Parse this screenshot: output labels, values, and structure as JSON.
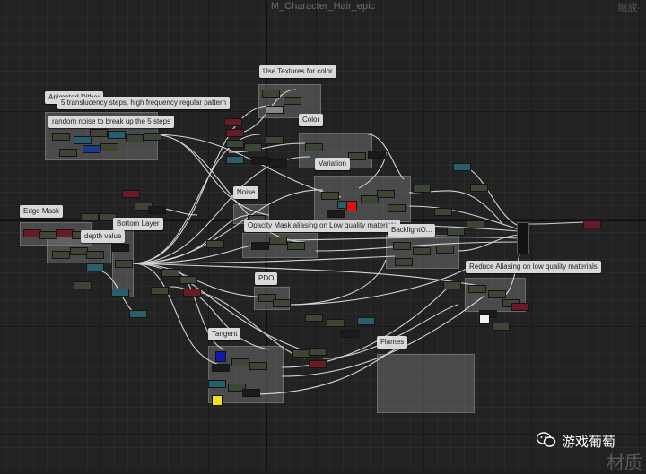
{
  "editor": {
    "title": "M_Character_Hair_epic",
    "zoom_label": "缩放-"
  },
  "comments": [
    {
      "id": "use-textures-for-color",
      "label": "Use Textures for color"
    },
    {
      "id": "animated-dither",
      "label": "Animated Dither"
    },
    {
      "id": "translucency-steps",
      "label": "5 translucency steps, high frequency regular pattern"
    },
    {
      "id": "random-noise",
      "label": "random noise to break up the 5 steps"
    },
    {
      "id": "color",
      "label": "Color"
    },
    {
      "id": "variation",
      "label": "Variation"
    },
    {
      "id": "noise",
      "label": "Noise"
    },
    {
      "id": "edge-mask",
      "label": "Edge Mask"
    },
    {
      "id": "bottom-layer",
      "label": "Bottom Layer"
    },
    {
      "id": "depth-value",
      "label": "depth value"
    },
    {
      "id": "opacity-mask",
      "label": "Opacity Mask aliasing on Low quality materials"
    },
    {
      "id": "backlight",
      "label": "BacklightO..."
    },
    {
      "id": "reduce-aliasing",
      "label": "Reduce Aliasing on low quality materials"
    },
    {
      "id": "pdo",
      "label": "PDO"
    },
    {
      "id": "tangent",
      "label": "Tangent"
    },
    {
      "id": "flames",
      "label": "Flames"
    }
  ],
  "watermark": {
    "icon": "wechat-icon",
    "text": "游戏葡萄",
    "corner_text": "材质"
  },
  "colors": {
    "background": "#222222",
    "comment_box": "#7d7d7d",
    "wire": "#e8e8e8",
    "label_bg": "#d9d9d9"
  }
}
